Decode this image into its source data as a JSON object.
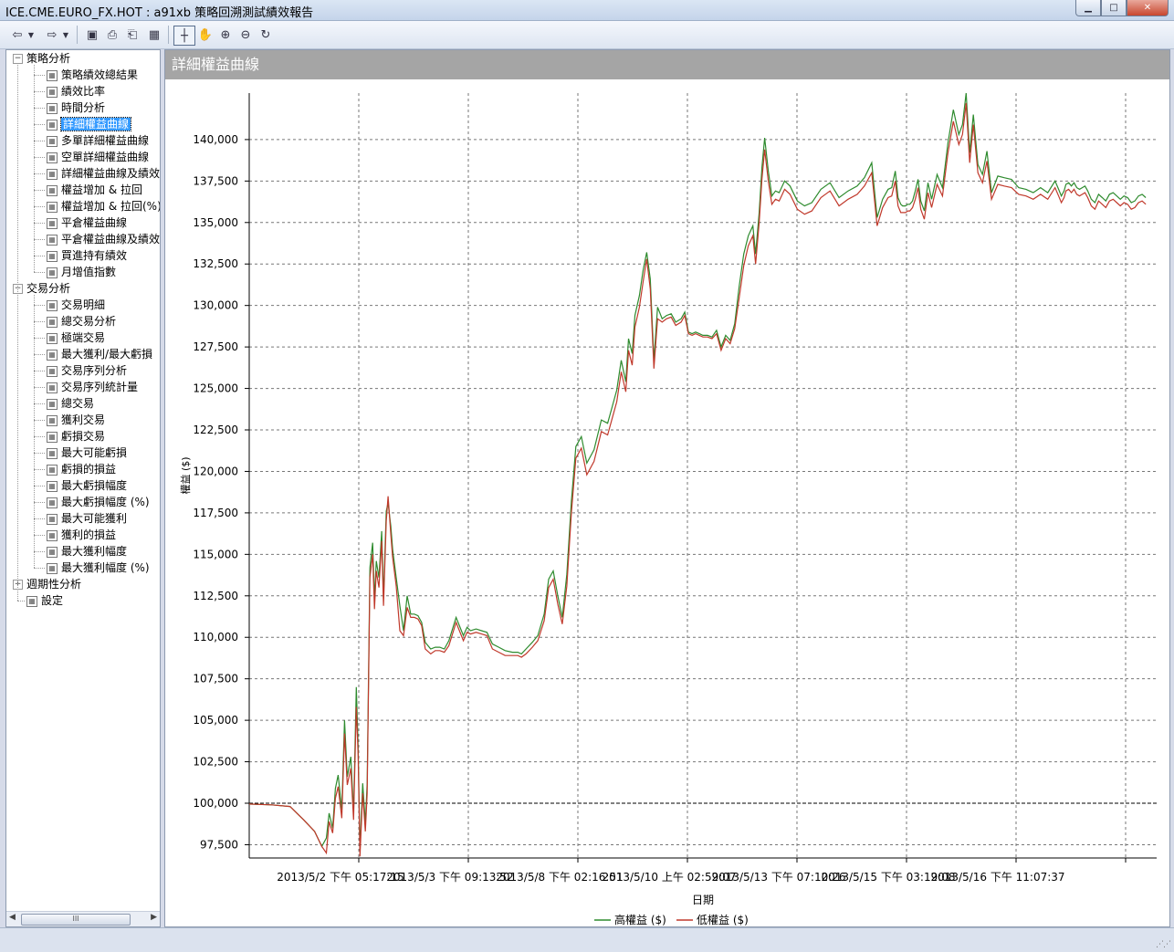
{
  "window": {
    "title": "ICE.CME.EURO_FX.HOT : a91xb 策略回溯測試績效報告",
    "buttons": [
      "▁",
      "□",
      "✕"
    ]
  },
  "toolbar": {
    "icons": [
      "back-icon",
      "back-dropdown-icon",
      "forward-icon",
      "forward-dropdown-icon",
      "save-icon",
      "preview-icon",
      "print-icon",
      "table-icon",
      "pointer-icon",
      "hand-icon",
      "zoom-in-icon",
      "zoom-out-icon",
      "reset-icon"
    ]
  },
  "tree": {
    "groups": [
      {
        "label": "策略分析",
        "expanded": true,
        "items": [
          "策略績效總結果",
          "績效比率",
          "時間分析",
          "詳細權益曲線",
          "多單詳細權益曲線",
          "空單詳細權益曲線",
          "詳細權益曲線及績效",
          "權益增加 & 拉回",
          "權益增加 & 拉回(%)",
          "平倉權益曲線",
          "平倉權益曲線及績效",
          "買進持有績效",
          "月增值指數"
        ]
      },
      {
        "label": "交易分析",
        "expanded": true,
        "items": [
          "交易明細",
          "總交易分析",
          "極端交易",
          "最大獲利/最大虧損",
          "交易序列分析",
          "交易序列統計量",
          "總交易",
          "獲利交易",
          "虧損交易",
          "最大可能虧損",
          "虧損的損益",
          "最大虧損幅度",
          "最大虧損幅度 (%)",
          "最大可能獲利",
          "獲利的損益",
          "最大獲利幅度",
          "最大獲利幅度 (%)"
        ]
      },
      {
        "label": "週期性分析",
        "expanded": false,
        "items": []
      }
    ],
    "settings_label": "設定",
    "selected": "詳細權益曲線",
    "scroll_marker": "III"
  },
  "panel": {
    "header": "詳細權益曲線"
  },
  "chart_data": {
    "type": "line",
    "title": "",
    "xlabel": "日期",
    "ylabel": "權益 ($)",
    "ylim": [
      96700,
      142800
    ],
    "yticks": [
      97500,
      100000,
      102500,
      105000,
      107500,
      110000,
      112500,
      115000,
      117500,
      120000,
      122500,
      125000,
      127500,
      130000,
      132500,
      135000,
      137500,
      140000
    ],
    "ytick_labels": [
      "97,500",
      "100,000",
      "102,500",
      "105,000",
      "107,500",
      "110,000",
      "112,500",
      "115,000",
      "117,500",
      "120,000",
      "122,500",
      "125,000",
      "127,500",
      "130,000",
      "132,500",
      "135,000",
      "137,500",
      "140,000"
    ],
    "x_tick_labels": [
      "2013/5/2 下午 05:17:15",
      "2013/5/3 下午 09:13:52",
      "2013/5/8 下午 02:16:51",
      "2013/5/10 上午 02:59:07",
      "2013/5/13 下午 07:10:26",
      "2013/5/15 下午 03:19:08",
      "2013/5/16 下午 11:07:37"
    ],
    "x_tick_count": 8,
    "reference_line": 100000,
    "grid": true,
    "legend_position": "bottom",
    "colors": {
      "high": "#2e8b2e",
      "low": "#c0392b"
    },
    "x": [
      0,
      25,
      45,
      60,
      72,
      80,
      85,
      88,
      92,
      95,
      98,
      102,
      105,
      108,
      112,
      115,
      118,
      120,
      122,
      125,
      128,
      130,
      133,
      136,
      138,
      140,
      143,
      146,
      148,
      151,
      153,
      156,
      158,
      162,
      166,
      170,
      174,
      178,
      182,
      186,
      190,
      194,
      200,
      205,
      210,
      215,
      220,
      228,
      236,
      240,
      244,
      250,
      256,
      262,
      268,
      275,
      282,
      290,
      296,
      300,
      305,
      312,
      318,
      325,
      330,
      335,
      340,
      345,
      350,
      355,
      360,
      366,
      372,
      380,
      388,
      395,
      400,
      405,
      410,
      415,
      418,
      422,
      425,
      430,
      434,
      438,
      442,
      446,
      450,
      455,
      460,
      465,
      470,
      476,
      480,
      484,
      488,
      492,
      496,
      500,
      505,
      510,
      515,
      520,
      525,
      530,
      535,
      540,
      545,
      550,
      555,
      558,
      562,
      565,
      568,
      572,
      576,
      580,
      584,
      590,
      596,
      604,
      612,
      620,
      630,
      640,
      650,
      660,
      670,
      678,
      686,
      692,
      698,
      704,
      708,
      712,
      715,
      718,
      720,
      723,
      726,
      728,
      731,
      734,
      737,
      740,
      744,
      748,
      752,
      758,
      764,
      770,
      776,
      782,
      786,
      790,
      794,
      798,
      803,
      808,
      813,
      818,
      825,
      832,
      840,
      848,
      856,
      864,
      872,
      880,
      888,
      892,
      895,
      898,
      900,
      903,
      906,
      909,
      912,
      915,
      918,
      921,
      924,
      928,
      932,
      936,
      940,
      944,
      948,
      952,
      956,
      960,
      964,
      968,
      972,
      976,
      980,
      984,
      988,
      992,
      996,
      1000
    ],
    "series": [
      {
        "name": "高權益 ($)",
        "values": [
          99950,
          99900,
          99800,
          99000,
          98300,
          97400,
          97900,
          99400,
          98500,
          100900,
          101700,
          99600,
          105000,
          101600,
          102800,
          99400,
          107000,
          103400,
          97200,
          101200,
          98800,
          101200,
          114200,
          115700,
          112300,
          114600,
          113600,
          116400,
          112400,
          117600,
          118100,
          116700,
          115300,
          113600,
          111900,
          110400,
          112500,
          111400,
          111400,
          111300,
          110900,
          109700,
          109300,
          109400,
          109400,
          109300,
          109800,
          111200,
          110100,
          110600,
          110400,
          110500,
          110400,
          110300,
          109600,
          109400,
          109200,
          109100,
          109100,
          109000,
          109300,
          109700,
          110100,
          111400,
          113500,
          114000,
          112500,
          111200,
          113800,
          118200,
          121500,
          122100,
          120500,
          121300,
          123100,
          122900,
          123900,
          124900,
          126700,
          125400,
          128000,
          127100,
          129400,
          130600,
          132100,
          133200,
          131600,
          126700,
          129900,
          129200,
          129400,
          129500,
          129000,
          129200,
          129600,
          128400,
          128300,
          128400,
          128300,
          128200,
          128200,
          128100,
          128500,
          127500,
          128200,
          127900,
          128900,
          131200,
          133100,
          134200,
          134800,
          133100,
          135600,
          138300,
          140100,
          138100,
          136600,
          136900,
          136800,
          137500,
          137200,
          136300,
          136000,
          136200,
          137000,
          137400,
          136500,
          136900,
          137200,
          137700,
          138600,
          135300,
          136400,
          137000,
          137100,
          138100,
          136500,
          136100,
          136000,
          136000,
          136100,
          136100,
          136300,
          136900,
          137600,
          136300,
          135700,
          137400,
          136400,
          137900,
          137100,
          139800,
          141800,
          140300,
          140900,
          142800,
          139200,
          141500,
          138500,
          137900,
          139300,
          136800,
          137800,
          137700,
          137600,
          137100,
          137000,
          136800,
          137100,
          136800,
          137500,
          137000,
          136600,
          136900,
          137300,
          137400,
          137200,
          137400,
          137100,
          137000,
          137100,
          137200,
          136900,
          136400,
          136200,
          136700,
          136500,
          136300,
          136700,
          136800,
          136600,
          136400,
          136600,
          136500,
          136200,
          136300,
          136600,
          136700,
          136500
        ]
      },
      {
        "name": "低權益 ($)",
        "values": [
          99950,
          99900,
          99800,
          99000,
          98300,
          97400,
          97000,
          98900,
          98200,
          100300,
          101000,
          99100,
          104200,
          101100,
          102100,
          99000,
          105800,
          102900,
          96800,
          100600,
          98300,
          100600,
          113600,
          115000,
          111700,
          114000,
          113000,
          115800,
          111900,
          117000,
          118500,
          116200,
          114800,
          113100,
          110400,
          110100,
          111800,
          111200,
          111200,
          111100,
          110700,
          109300,
          109000,
          109200,
          109200,
          109100,
          109500,
          110900,
          109800,
          110300,
          110200,
          110300,
          110200,
          110100,
          109300,
          109100,
          108900,
          108900,
          108900,
          108800,
          109000,
          109400,
          109800,
          111000,
          113000,
          113500,
          112000,
          110800,
          113100,
          117500,
          120800,
          121400,
          119800,
          120600,
          122400,
          122200,
          123200,
          124200,
          126000,
          124800,
          127300,
          126400,
          128700,
          129900,
          131400,
          132800,
          131000,
          126200,
          129200,
          129000,
          129200,
          129300,
          128800,
          129000,
          129400,
          128300,
          128200,
          128300,
          128200,
          128100,
          128100,
          128000,
          128300,
          127300,
          128000,
          127700,
          128600,
          130500,
          132400,
          133600,
          134200,
          132500,
          135000,
          137600,
          139400,
          137500,
          136100,
          136400,
          136300,
          137000,
          136700,
          135800,
          135500,
          135700,
          136500,
          136900,
          136000,
          136400,
          136700,
          137200,
          138000,
          134800,
          135900,
          136500,
          136600,
          137500,
          136000,
          135600,
          135600,
          135600,
          135700,
          135700,
          135900,
          136400,
          137100,
          135800,
          135200,
          136800,
          135900,
          137300,
          136600,
          139200,
          141100,
          139700,
          140300,
          142200,
          138600,
          140900,
          138000,
          137400,
          138700,
          136400,
          137300,
          137200,
          137100,
          136700,
          136600,
          136400,
          136700,
          136400,
          137100,
          136600,
          136200,
          136500,
          136900,
          137000,
          136800,
          137000,
          136700,
          136600,
          136700,
          136800,
          136500,
          136000,
          135800,
          136300,
          136100,
          135900,
          136300,
          136400,
          136200,
          136000,
          136200,
          136100,
          135800,
          135900,
          136200,
          136300,
          136100
        ]
      }
    ]
  }
}
